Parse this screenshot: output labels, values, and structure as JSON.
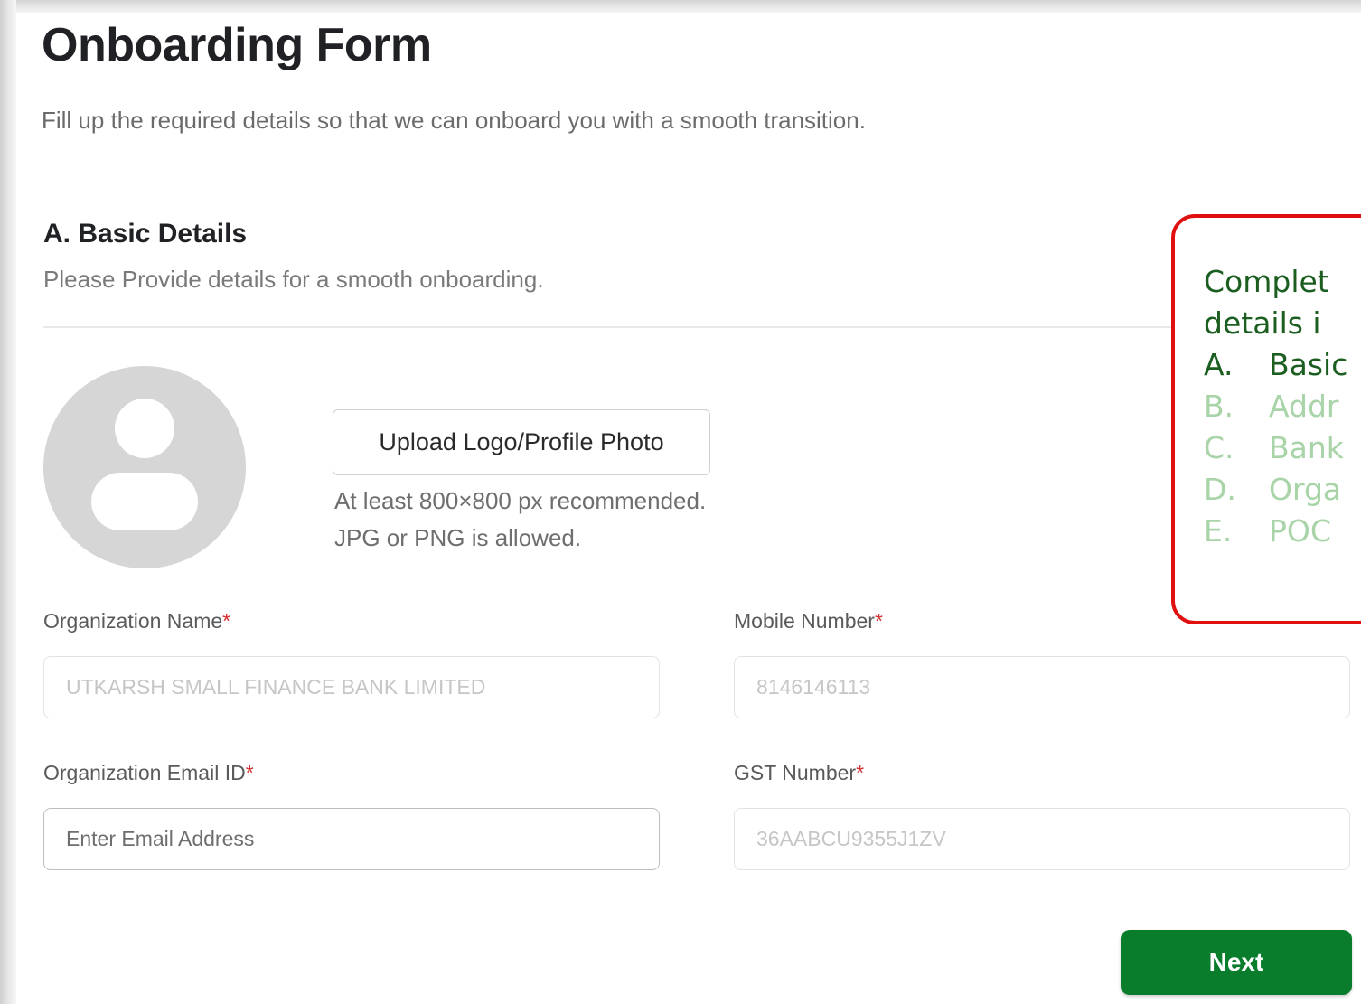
{
  "form": {
    "title": "Onboarding Form",
    "subtitle": "Fill up the required details so that we can onboard you with a smooth transition."
  },
  "section": {
    "title": "A. Basic Details",
    "description": "Please Provide details for a smooth onboarding."
  },
  "upload": {
    "button_label": "Upload Logo/Profile Photo",
    "hint_line1": "At least 800×800 px recommended.",
    "hint_line2": "JPG or PNG is allowed."
  },
  "fields": {
    "org_name": {
      "label": "Organization Name",
      "required_mark": "*",
      "placeholder": "UTKARSH SMALL FINANCE BANK LIMITED"
    },
    "mobile": {
      "label": "Mobile Number",
      "required_mark": "*",
      "placeholder": "8146146113"
    },
    "email": {
      "label": "Organization Email ID",
      "required_mark": "*",
      "placeholder": "Enter Email Address"
    },
    "gst": {
      "label": "GST Number",
      "required_mark": "*",
      "placeholder": "36AABCU9355J1ZV"
    }
  },
  "actions": {
    "next_label": "Next"
  },
  "callout": {
    "line1": "Complet",
    "line2": "details i",
    "steps": [
      {
        "letter": "A.",
        "text": "Basic",
        "state": "active"
      },
      {
        "letter": "B.",
        "text": "Addr",
        "state": "inactive"
      },
      {
        "letter": "C.",
        "text": "Bank",
        "state": "inactive"
      },
      {
        "letter": "D.",
        "text": "Orga",
        "state": "inactive"
      },
      {
        "letter": "E.",
        "text": "POC",
        "state": "inactive"
      }
    ]
  },
  "colors": {
    "primary_green": "#0a7d2c",
    "callout_border": "#e01010",
    "callout_text": "#1b5e20",
    "callout_inactive": "#a8d4a8",
    "required_star": "#d32f2f"
  }
}
